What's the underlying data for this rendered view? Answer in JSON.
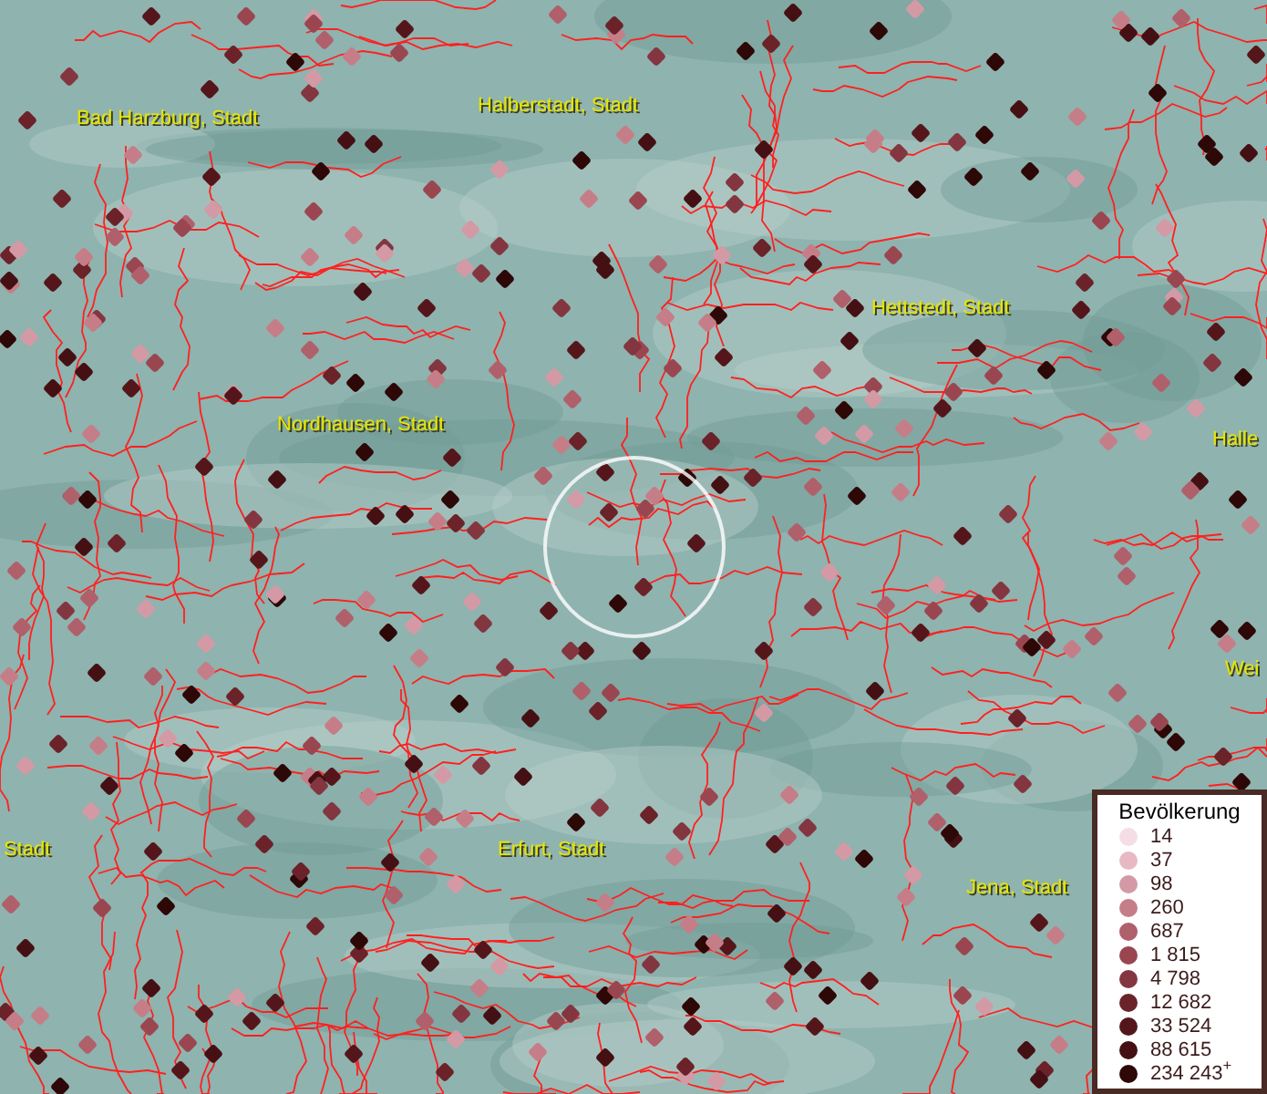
{
  "map": {
    "place_labels": [
      "Bad Harzburg, Stadt",
      "Halberstadt, Stadt",
      "Hettstedt, Stadt",
      "Nordhausen, Stadt",
      "Halle",
      "Wei",
      "Stadt",
      "Erfurt, Stadt",
      "Jena, Stadt"
    ]
  },
  "legend": {
    "title": "Bevölkerung",
    "items": [
      {
        "label": "14",
        "color": "#f5dde6"
      },
      {
        "label": "37",
        "color": "#e8b9c4"
      },
      {
        "label": "98",
        "color": "#d39aa5"
      },
      {
        "label": "260",
        "color": "#c57e88"
      },
      {
        "label": "687",
        "color": "#b0606b"
      },
      {
        "label": "1 815",
        "color": "#9a4650"
      },
      {
        "label": "4 798",
        "color": "#833640"
      },
      {
        "label": "12 682",
        "color": "#6b2229"
      },
      {
        "label": "33 524",
        "color": "#55161b"
      },
      {
        "label": "88 615",
        "color": "#451013"
      },
      {
        "label": "234 243$^{+}$",
        "color": "#2e0707"
      }
    ]
  }
}
